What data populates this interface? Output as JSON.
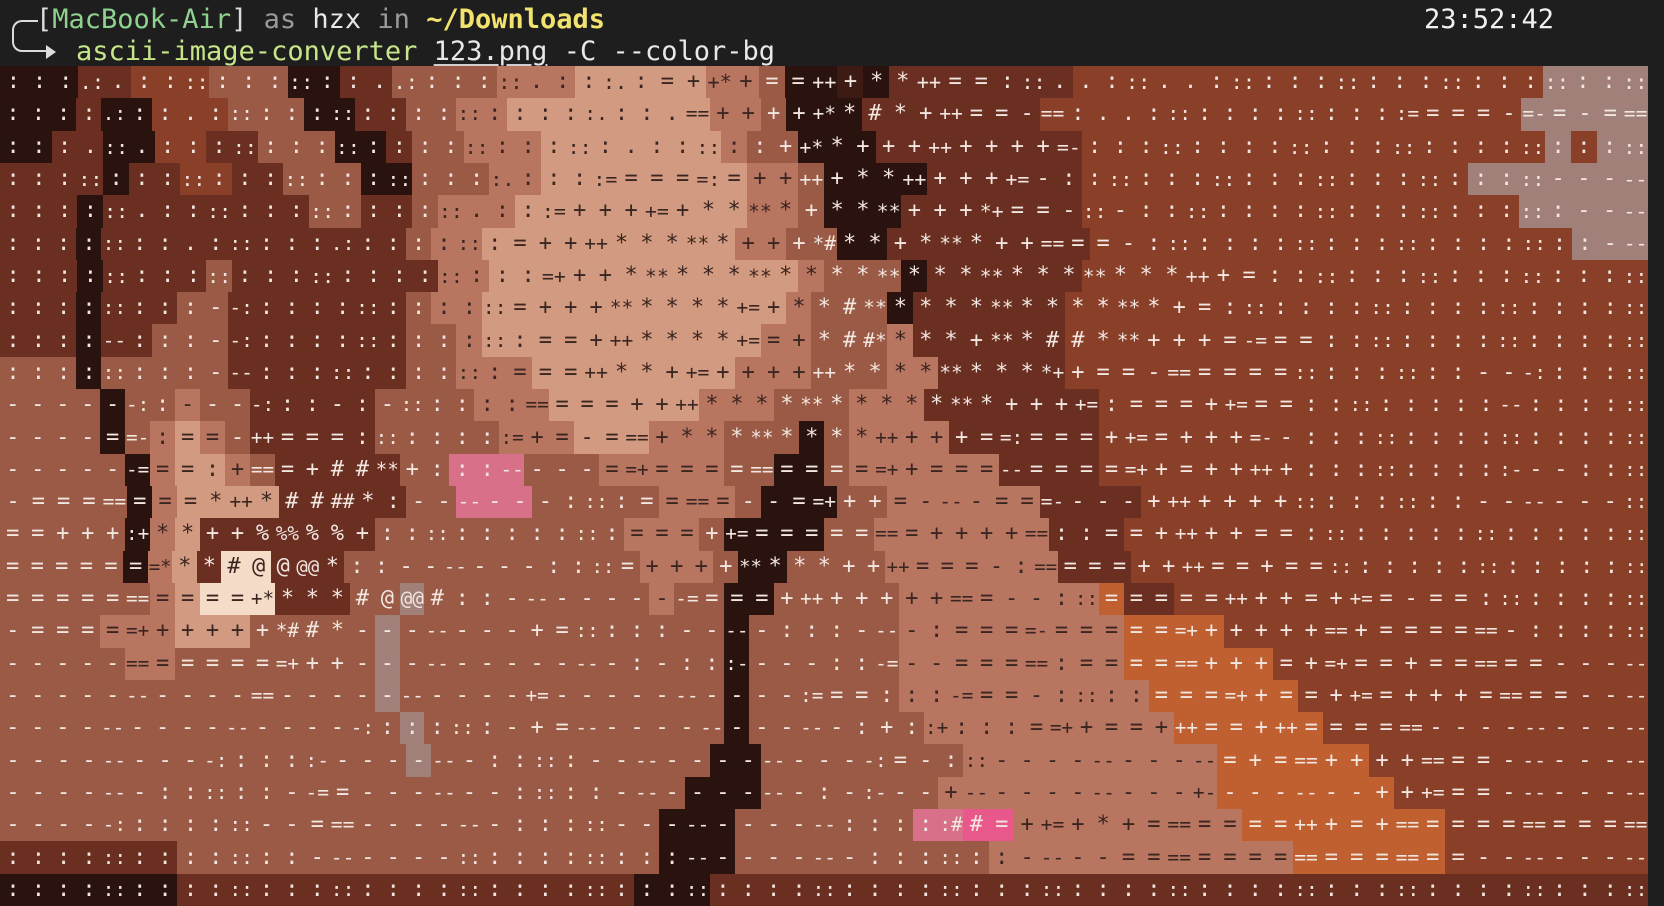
{
  "terminal": {
    "prompt": {
      "open_bracket": "[",
      "host": "MacBook-Air",
      "close_bracket": "]",
      "as_word": " as ",
      "user": "hzx",
      "in_word": " in ",
      "cwd": "~/Downloads",
      "command": "ascii-image-converter",
      "arg_file": "123.png",
      "arg_flags": "-C --color-bg"
    },
    "clock": "23:52:42"
  },
  "ascii_image": {
    "source_file": "123.png",
    "columns": 52,
    "rows": 26,
    "palette": {
      "dark": "#2a120e",
      "deep": "#3d1a14",
      "brown": "#6b2f22",
      "rust": "#8a3f28",
      "skin_dark": "#9a5a45",
      "skin": "#b87560",
      "skin_light": "#d29a80",
      "highlight": "#e8c0a8",
      "bright": "#f4dcc8",
      "pink": "#d8708a",
      "hot_pink": "#e8588a",
      "orange": "#c06030",
      "grey": "#a08078"
    },
    "text_rows": [
      ":::.:.:::::::::::..::::::.:::.:=++*+==+++**++==:::..:::..::::::::::::::::::::::",
      "::::.:::.:::::::::::::::::::.::.==+++++**#*+++==-==:..:::::::::::::====-=-=-===",
      ":::.::.::::::::::::::::::::::.::::::++**+++++++++=-:::::::::::::::::::::::::::",
      "::::::::::::::::::::::::.::::=====:=+++++**++++++=-::::::::::::::::::::::::-----",
      "::::::.:::::::::::::::.:::=++++=+*****+****+++*+==-::-:::::::::::::::::::::----",
      "::::::::.::::::.::::::::=++++******+++*#**+****++====-::::::::::::::::::::::---",
      ":::::::::::::::::::::::::=+++***************************+++=:::::::::::::::::::",
      ":::::::::--:::::::::::::=+++******+=+**#***************+=:::::::::::::::::::::",
      "::::--:::--::::::::::::::==+++****+==+*##****+***##***+++=-===::::::::::::::::",
      ":::::::::---::::::::::::===++**++=++++++**********++==-======:::::::::---::::::",
      "------::----:::-:-::::::=====++++**************++++=:===++===:::::::::--::::::",
      "----==-:==-++===::::::::=+=-===+*********+++++==:===++==+++=--:::::::::::::::::",
      "------===:+===+##**+:::-----==+===========++===--=====++=+++++::::::::::---::::",
      "-========*++*####*:-------::::=====--==+++=----===----+++++++:::::::::-------::",
      "==+++:+**++%%%%%+::::::::::::===++=========++++==::==+++++==:::::::::::::::::",
      "=======***#@@@@*::-------::::=++++*****++++===-:=====++++==+==::::::::::::::::",
      "===========+****#@@@#::---------====++++++++===--:::=====++++=++==-==:::::::::",
      "-=====++++++*##*--------+=:::::-----:::----:====-======++++++==+======-::::::",
      "-----========+++-------------:-:::----::-=--=====:======+++=+=+==+======-----",
      "-----------==-----------+=-----------:===:::-===-:::::====++==++==+++=====----",
      "-----------------:::::::-+=--------------:+::+:::==++==+++==+++======-----------",
      "----------:::::--------:::::--------------:=-:::-----------=+===++++====--------",
      "-------::::::--==-------:::::----------:-:---+-----------+--------+++===--------",
      "-----:::::::--===-------:::::-----------:::::##=++=+*+=======+++=+=============",
      "::::::::::::::-------:::::::::::---------:::::::-----=================---------",
      ":::::::::::::::::::::::::::::::::::::::::::::::::::::::::::::::::::::::::::::::"
    ],
    "color_rows": [
      "dddbbrrrsssddbbsssslllhhhhhllsddkdbbbbbbbrrrrrrrrrrrrrrrrrrgggg",
      "dddbddrrrsssddbbssllhhhhhhhhllsdddbbbbbbbrrrrrrrrrrrrrrrrrrrggggg",
      "ddbbddrrbbsssddbsslllhhhhhhhlssdddbbbbbbbbrrrrrrrrrrrrrrrrrrgrgg",
      "bbbbdbbrrbbsssddsssllhhhhhhhhllsddddbbbbbbrrrrrrrrrrrrrrrggggggg",
      "bbbdbbbbbbbbssbbslllhhhhhhhhhllsdddbbbbbbbrrrrrrrrrrrrrrrrrggggg",
      "bbbdbbbbbbbbbbbbsllhhhhhhhhhhllssddbbbbbbbbrrrrrrrrrrrrrrrrrrrggg",
      "bbbdbbbbsbbbbbbbbllhhhhhhhhhhhhlsssdbbbbbbrrrrrrrrrrrrrrrrrrrrrr",
      "bbbdbbbssbbbbbbbsllhhhhhhhhhhhhlsssdbbbbbbrrrrrrrrrrrrrrrrrrrrrrr",
      "bbbdbbsssbbbbbbbsslhhhhhhhhhhhllssslbbbbbbrrrrrrrrrrrrrrrrrrrrrrr",
      "sssdsssssbbbbbbbsslllhhhhhhhhlllsssllbbbbbrrrrrrrrrrrrrrrrrrrrrrr",
      "ssssdsslssbbbbbsssslllhhhhhhlllssslllbbbbbbbrrrrrrrrrrrrrrrrrrrrrr",
      "ssssdslhlsbbbbbssssslllhhhlllsssdsllllbbbbbbrrrrrrrrrrrrrrrrrrrrrr",
      "sssssdlhhlsbbbbbsspppssslllllssddsllllllbbbbrrrrrrrrrrrrrrrrrrrrrr",
      "sssssdlhhhhbbbbbsspppssssslllsdddssllllllbbbbrrrrrrrrrrrrrrrrrrrr",
      "sssssdlhbbbbbbbsssssssssslllsddddsslllllllbbbrrrrrrrrrrrrrrrrrrrrr",
      "sssssdlhbBBbbbsssssssssssslllsddsssslllllllbbbrrrrrrrrrrrrrrrrrrrrr",
      "sssssslhBBBbbbssgssssssssslssddsssssllllllllobbrrrrrrrrrrrrrrrrrrr",
      "sssslllhhhsssssgsssssssssssssdssssssllllllllloooorrrrrrrrrrrrrrrrr",
      "sssssllssssssssgsssssssssssssdssssssllllllllloooooorrrrrrrrrrrrrrr",
      "sssssssssssssssgsssssssssssssdsssssslllllllllloooooorrrrrrrrrrrrrr",
      "ssssssssssssssssgssssssssssssdssssssslllllllllloooooorrrrrrrrrrrrr",
      "ssssssssssssssssgsssssssssssddsssssssslllllllllloooooorrrrrrrrrrr",
      "sssssssssssssssssssssssssssdddssssssslllllllllllooooooorrrrrrrrrr",
      "ssssssssssssssssssssssssssdddsssssssppPPllllllllloooooooorrrrrrrr",
      "bbbbbbbsssssssssssssssssssdddsssssssssslllllllllllloooooorrrrrrrr",
      "dddddddbbbbbbbbbbbbbbbbbbdddbbbbbbbbbbbbbbbbbbbbbbbbbbbbbbbbbbbbb"
    ]
  }
}
